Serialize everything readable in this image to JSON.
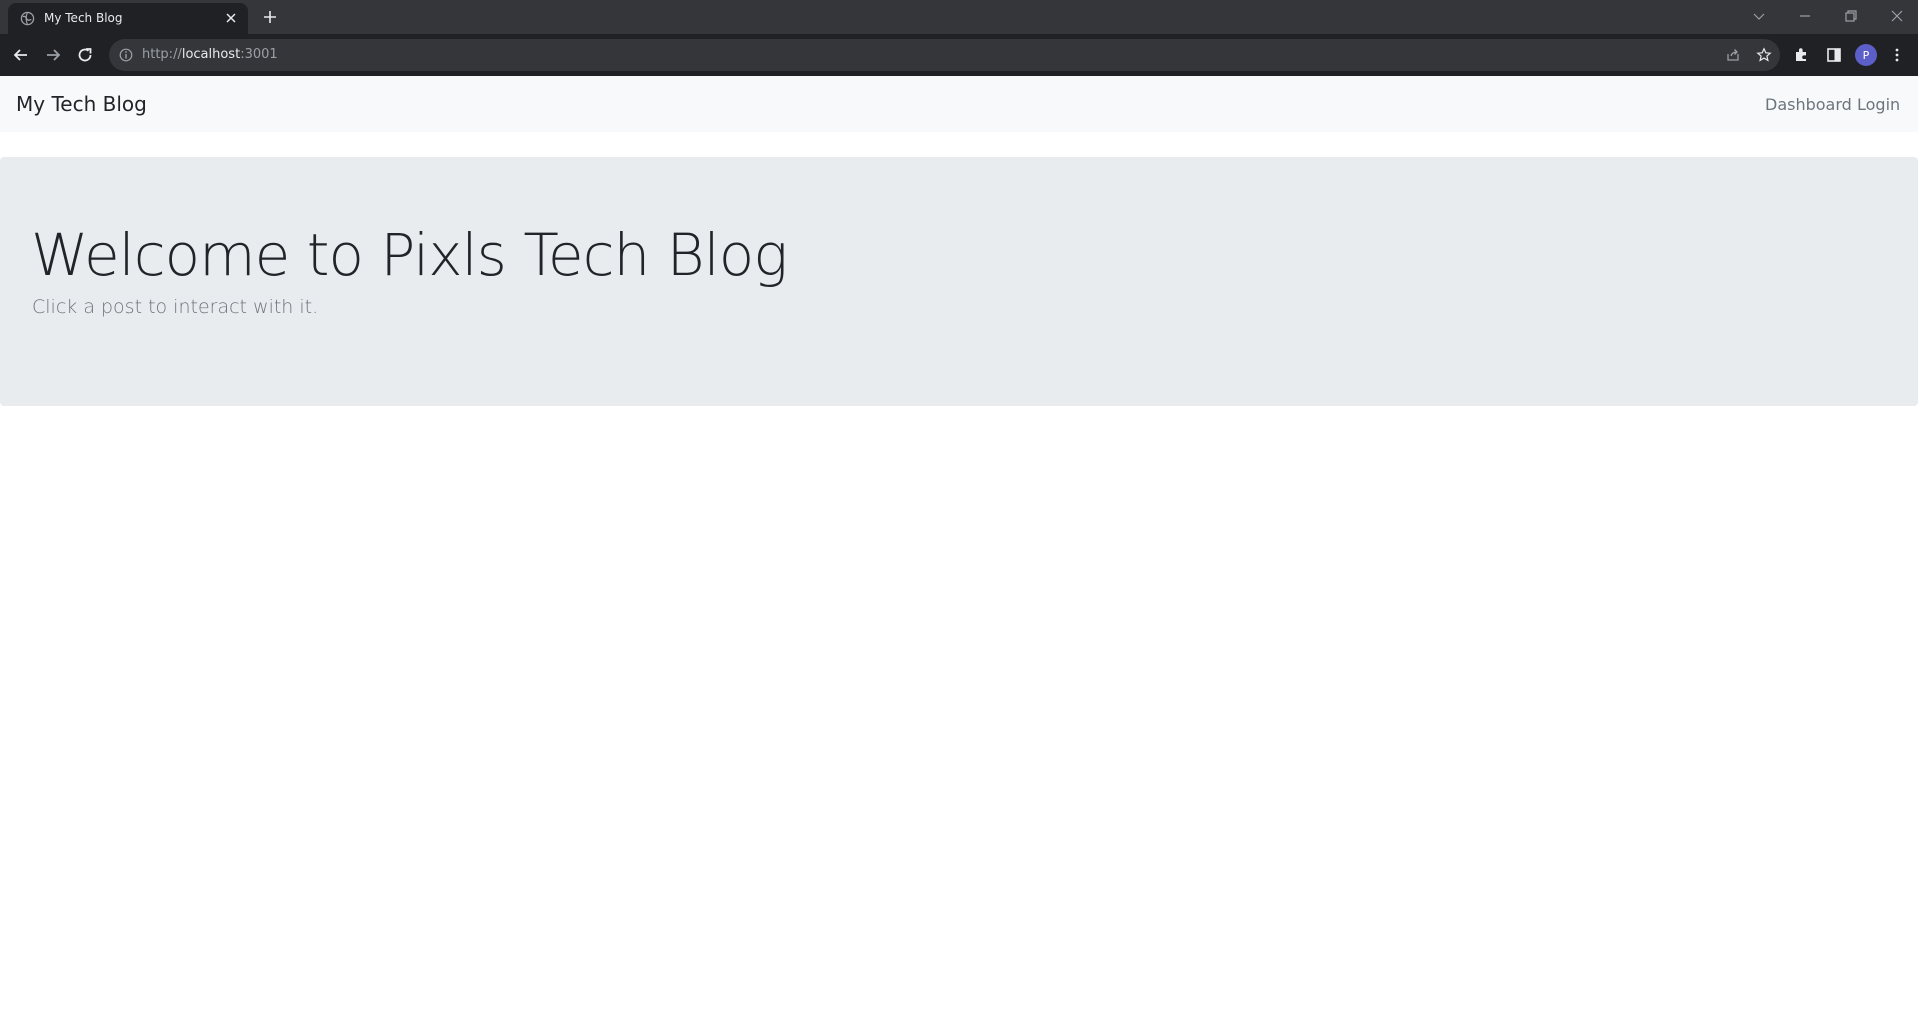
{
  "browser": {
    "tab_title": "My Tech Blog",
    "url_scheme": "http://",
    "url_host": "localhost",
    "url_port": ":3001",
    "profile_initial": "P",
    "colors": {
      "tabstrip": "#35363a",
      "toolbar": "#202124",
      "omnibox": "#35363a",
      "avatar": "#5b5fc7"
    }
  },
  "navbar": {
    "brand": "My Tech Blog",
    "links": [
      {
        "label": "Dashboard"
      },
      {
        "label": "Login"
      }
    ]
  },
  "hero": {
    "title": "Welcome to Pixls Tech Blog",
    "subtitle": "Click a post to interact with it."
  },
  "icons": [
    "globe-icon",
    "close-icon",
    "plus-icon",
    "chevron-down-icon",
    "minimize-icon",
    "restore-icon",
    "back-icon",
    "forward-icon",
    "reload-icon",
    "info-icon",
    "share-icon",
    "star-icon",
    "extensions-icon",
    "side-panel-icon",
    "menu-icon"
  ]
}
